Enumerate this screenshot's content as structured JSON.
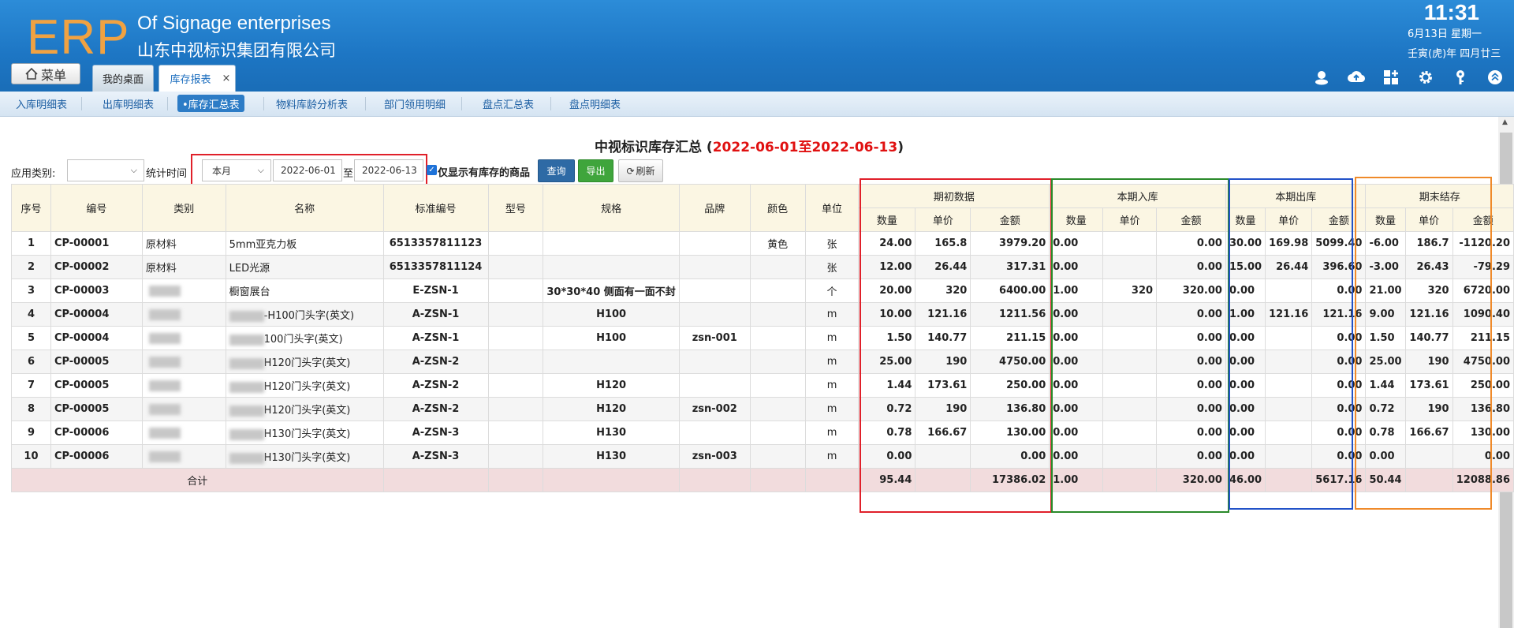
{
  "header": {
    "logo": "ERP",
    "company_en": "Of Signage enterprises",
    "company_cn": "山东中视标识集团有限公司",
    "clock": "11:31",
    "date_line1": "6月13日 星期一",
    "date_line2": "壬寅(虎)年 四月廿三",
    "menu_label": "菜单",
    "tabs": [
      {
        "label": "我的桌面"
      },
      {
        "label": "库存报表",
        "close": "×"
      }
    ],
    "icons": [
      "user-icon",
      "cloud-upload-icon",
      "grid-plus-icon",
      "gear-icon",
      "key-icon",
      "collapse-up-icon"
    ]
  },
  "subnav": {
    "items": [
      "入库明细表",
      "出库明细表",
      "•库存汇总表",
      "物料库龄分析表",
      "部门领用明细",
      "盘点汇总表",
      "盘点明细表"
    ],
    "active_index": 2
  },
  "report": {
    "title_prefix": "中视标识库存汇总 (",
    "title_range": "2022-06-01至2022-06-13",
    "title_suffix": ")",
    "filters": {
      "category_label": "应用类别:",
      "category_value": "",
      "period_label": "统计时间",
      "period_value": "本月",
      "date_from": "2022-06-01",
      "to_label": "至",
      "date_to": "2022-06-13",
      "stock_only_checked": true,
      "stock_only_label": "仅显示有库存的商品"
    },
    "buttons": {
      "query": "查询",
      "export": "导出",
      "refresh": "刷新"
    }
  },
  "table": {
    "columns": [
      "序号",
      "编号",
      "类别",
      "名称",
      "标准编号",
      "型号",
      "规格",
      "品牌",
      "颜色",
      "单位"
    ],
    "groups": [
      "期初数据",
      "本期入库",
      "本期出库",
      "期末结存"
    ],
    "sub_columns": [
      "数量",
      "单价",
      "金额"
    ],
    "rows": [
      {
        "no": "1",
        "code": "CP-00001",
        "cat": "原材料",
        "name": "5mm亚克力板",
        "std": "6513357811123",
        "model": "",
        "spec": "",
        "brand": "",
        "color": "黄色",
        "unit": "张",
        "open": [
          "24.00",
          "165.8",
          "3979.20"
        ],
        "in": [
          "0.00",
          "",
          "0.00"
        ],
        "out": [
          "30.00",
          "169.98",
          "5099.40"
        ],
        "end": [
          "-6.00",
          "186.7",
          "-1120.20"
        ]
      },
      {
        "no": "2",
        "code": "CP-00002",
        "cat": "原材料",
        "name": "LED光源",
        "std": "6513357811124",
        "model": "",
        "spec": "",
        "brand": "",
        "color": "",
        "unit": "张",
        "open": [
          "12.00",
          "26.44",
          "317.31"
        ],
        "in": [
          "0.00",
          "",
          "0.00"
        ],
        "out": [
          "15.00",
          "26.44",
          "396.60"
        ],
        "end": [
          "-3.00",
          "26.43",
          "-79.29"
        ]
      },
      {
        "no": "3",
        "code": "CP-00003",
        "cat": "",
        "name": "橱窗展台",
        "std": "E-ZSN-1",
        "model": "",
        "spec": "30*30*40 侧面有一面不封",
        "brand": "",
        "color": "",
        "unit": "个",
        "open": [
          "20.00",
          "320",
          "6400.00"
        ],
        "in": [
          "1.00",
          "320",
          "320.00"
        ],
        "out": [
          "0.00",
          "",
          "0.00"
        ],
        "end": [
          "21.00",
          "320",
          "6720.00"
        ]
      },
      {
        "no": "4",
        "code": "CP-00004",
        "cat": "",
        "name": "-H100门头字(英文)",
        "std": "A-ZSN-1",
        "model": "",
        "spec": "H100",
        "brand": "",
        "color": "",
        "unit": "m",
        "open": [
          "10.00",
          "121.16",
          "1211.56"
        ],
        "in": [
          "0.00",
          "",
          "0.00"
        ],
        "out": [
          "1.00",
          "121.16",
          "121.16"
        ],
        "end": [
          "9.00",
          "121.16",
          "1090.40"
        ]
      },
      {
        "no": "5",
        "code": "CP-00004",
        "cat": "",
        "name": "100门头字(英文)",
        "std": "A-ZSN-1",
        "model": "",
        "spec": "H100",
        "brand": "zsn-001",
        "color": "",
        "unit": "m",
        "open": [
          "1.50",
          "140.77",
          "211.15"
        ],
        "in": [
          "0.00",
          "",
          "0.00"
        ],
        "out": [
          "0.00",
          "",
          "0.00"
        ],
        "end": [
          "1.50",
          "140.77",
          "211.15"
        ]
      },
      {
        "no": "6",
        "code": "CP-00005",
        "cat": "",
        "name": "H120门头字(英文)",
        "std": "A-ZSN-2",
        "model": "",
        "spec": "",
        "brand": "",
        "color": "",
        "unit": "m",
        "open": [
          "25.00",
          "190",
          "4750.00"
        ],
        "in": [
          "0.00",
          "",
          "0.00"
        ],
        "out": [
          "0.00",
          "",
          "0.00"
        ],
        "end": [
          "25.00",
          "190",
          "4750.00"
        ]
      },
      {
        "no": "7",
        "code": "CP-00005",
        "cat": "",
        "name": "H120门头字(英文)",
        "std": "A-ZSN-2",
        "model": "",
        "spec": "H120",
        "brand": "",
        "color": "",
        "unit": "m",
        "open": [
          "1.44",
          "173.61",
          "250.00"
        ],
        "in": [
          "0.00",
          "",
          "0.00"
        ],
        "out": [
          "0.00",
          "",
          "0.00"
        ],
        "end": [
          "1.44",
          "173.61",
          "250.00"
        ]
      },
      {
        "no": "8",
        "code": "CP-00005",
        "cat": "",
        "name": "H120门头字(英文)",
        "std": "A-ZSN-2",
        "model": "",
        "spec": "H120",
        "brand": "zsn-002",
        "color": "",
        "unit": "m",
        "open": [
          "0.72",
          "190",
          "136.80"
        ],
        "in": [
          "0.00",
          "",
          "0.00"
        ],
        "out": [
          "0.00",
          "",
          "0.00"
        ],
        "end": [
          "0.72",
          "190",
          "136.80"
        ]
      },
      {
        "no": "9",
        "code": "CP-00006",
        "cat": "",
        "name": "H130门头字(英文)",
        "std": "A-ZSN-3",
        "model": "",
        "spec": "H130",
        "brand": "",
        "color": "",
        "unit": "m",
        "open": [
          "0.78",
          "166.67",
          "130.00"
        ],
        "in": [
          "0.00",
          "",
          "0.00"
        ],
        "out": [
          "0.00",
          "",
          "0.00"
        ],
        "end": [
          "0.78",
          "166.67",
          "130.00"
        ]
      },
      {
        "no": "10",
        "code": "CP-00006",
        "cat": "",
        "name": "H130门头字(英文)",
        "std": "A-ZSN-3",
        "model": "",
        "spec": "H130",
        "brand": "zsn-003",
        "color": "",
        "unit": "m",
        "open": [
          "0.00",
          "",
          "0.00"
        ],
        "in": [
          "0.00",
          "",
          "0.00"
        ],
        "out": [
          "0.00",
          "",
          "0.00"
        ],
        "end": [
          "0.00",
          "",
          "0.00"
        ]
      }
    ],
    "total": {
      "label": "合计",
      "open": [
        "95.44",
        "",
        "17386.02"
      ],
      "in": [
        "1.00",
        "",
        "320.00"
      ],
      "out": [
        "46.00",
        "",
        "5617.16"
      ],
      "end": [
        "50.44",
        "",
        "12088.86"
      ]
    }
  },
  "annotation_colors": {
    "open_box": "#e0202a",
    "in_box": "#2a8a2a",
    "out_box": "#2252c8",
    "end_box": "#ef8a2a",
    "filter_box": "#e0202a"
  }
}
